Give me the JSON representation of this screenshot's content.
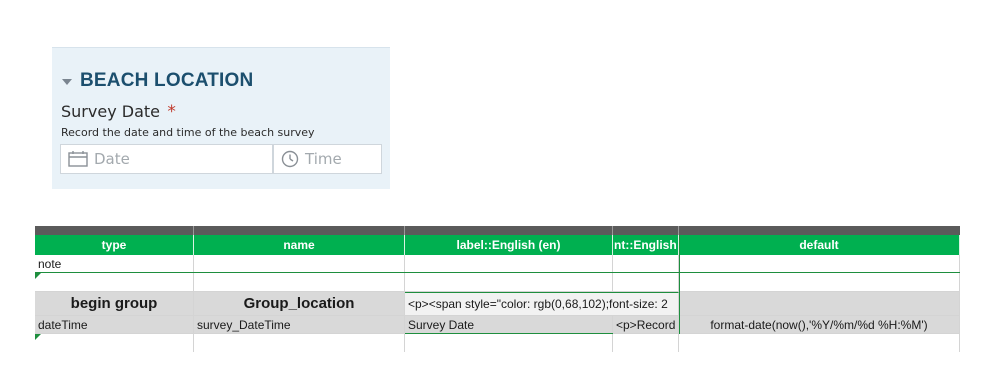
{
  "form": {
    "group_title": "BEACH LOCATION",
    "question_label": "Survey Date",
    "required_mark": "*",
    "hint": "Record the date and time of the beach survey",
    "date_placeholder": "Date",
    "time_placeholder": "Time",
    "icons": [
      "caret-down-icon",
      "calendar-icon",
      "clock-icon"
    ]
  },
  "spreadsheet": {
    "headers": [
      "type",
      "name",
      "label::English (en)",
      "nt::English (e",
      "default"
    ],
    "rows": [
      [
        "note",
        "",
        "",
        "",
        ""
      ],
      [
        "",
        "",
        "",
        "",
        ""
      ],
      [
        "begin group",
        "Group_location",
        "<p><span style=\"color: rgb(0,68,102);font-size: 2",
        "",
        ""
      ],
      [
        "dateTime",
        "survey_DateTime",
        "Survey Date",
        "<p>Record t",
        "format-date(now(),'%Y/%m/%d %H:%M')"
      ],
      [
        "",
        "",
        "",
        "",
        ""
      ]
    ],
    "header_color": "#00b050",
    "group_row_color": "#d9d9d9",
    "marker_color": "#1e8e3e"
  },
  "colors": {
    "form_background": "#e9f2f8",
    "group_title": "#1c4f6e",
    "required": "#c0392b"
  }
}
